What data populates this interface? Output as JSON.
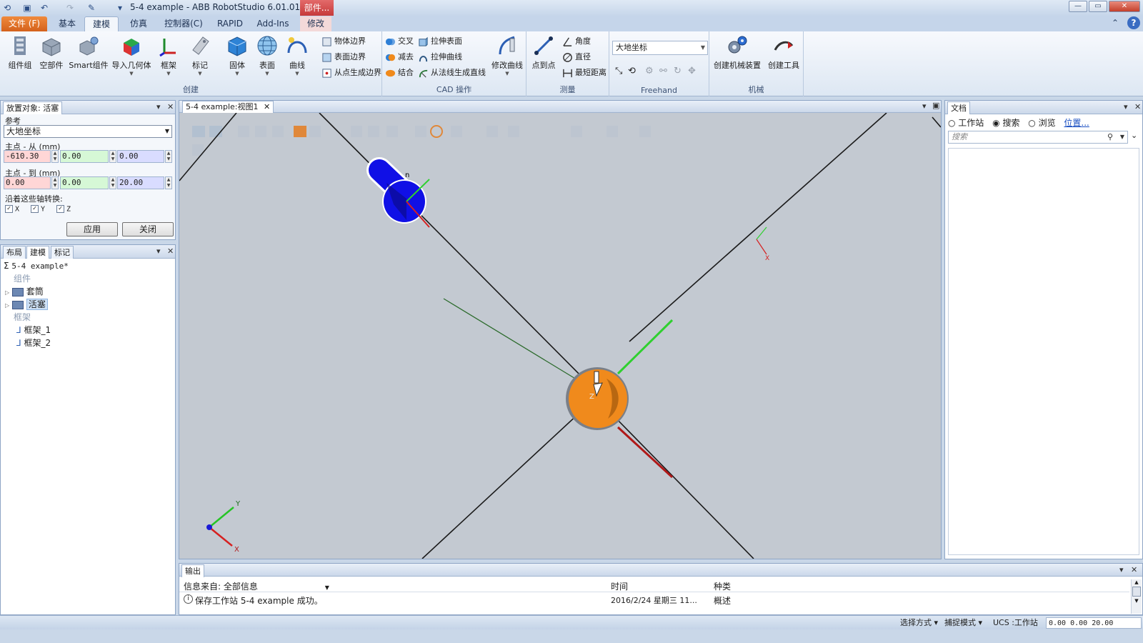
{
  "window": {
    "title": "5-4 example - ABB RobotStudio 6.01.01",
    "context_tab": "部件..."
  },
  "quick_access": [
    "app-icon",
    "save-icon",
    "undo-icon",
    "redo-icon",
    "tool-icon",
    "customize-icon"
  ],
  "tabs": {
    "file": "文件 (F)",
    "basic": "基本",
    "modeling": "建模",
    "simulation": "仿真",
    "controller": "控制器(C)",
    "rapid": "RAPID",
    "addins": "Add-Ins",
    "modify": "修改"
  },
  "ribbon": {
    "create": {
      "label": "创建",
      "component_group": "组件组",
      "empty_part": "空部件",
      "smart_component": "Smart组件",
      "import_geometry": "导入几何体",
      "frame": "框架",
      "tag": "标记",
      "solid": "固体",
      "surface": "表面",
      "curve": "曲线",
      "body_border": "物体边界",
      "surface_border": "表面边界",
      "border_from_point": "从点生成边界"
    },
    "cad": {
      "label": "CAD 操作",
      "intersect": "交叉",
      "subtract": "减去",
      "union": "结合",
      "extrude_surface": "拉伸表面",
      "extrude_curve": "拉伸曲线",
      "line_from_normal": "从法线生成直线",
      "modify_curve": "修改曲线"
    },
    "measure": {
      "label": "测量",
      "point_to_point": "点到点",
      "angle": "角度",
      "diameter": "直径",
      "min_distance": "最短距离"
    },
    "freehand": {
      "label": "Freehand",
      "reference": "大地坐标"
    },
    "mechanism": {
      "label": "机械",
      "create_mechanism": "创建机械装置",
      "create_tool": "创建工具"
    }
  },
  "place_panel": {
    "title": "放置对象: 活塞",
    "reference_label": "参考",
    "reference_value": "大地坐标",
    "from_label": "主点 - 从 (mm)",
    "from_x": "-610.30",
    "from_y": "0.00",
    "from_z": "0.00",
    "to_label": "主点 - 到 (mm)",
    "to_x": "0.00",
    "to_y": "0.00",
    "to_z": "20.00",
    "axes_label": "沿着这些轴转换:",
    "axis_x": "X",
    "axis_y": "Y",
    "axis_z": "Z",
    "apply": "应用",
    "close": "关闭"
  },
  "browser": {
    "tabs": [
      "布局",
      "建模",
      "标记"
    ],
    "station": "5-4 example*",
    "components_label": "组件",
    "parts": [
      "套筒",
      "活塞"
    ],
    "frames_label": "框架",
    "frames": [
      "框架_1",
      "框架_2"
    ]
  },
  "viewport": {
    "tab": "5-4 example:视图1",
    "axis_x": "X",
    "axis_y": "Y",
    "axis_z": "Z",
    "mark_n": "n"
  },
  "documents": {
    "title": "文档",
    "opt_station": "工作站",
    "opt_search": "搜索",
    "opt_browse": "浏览",
    "location_link": "位置...",
    "search_placeholder": "搜索"
  },
  "output": {
    "title": "输出",
    "source_label": "信息来自: 全部信息",
    "col_time": "时间",
    "col_type": "种类",
    "message": "保存工作站 5-4 example 成功。",
    "time": "2016/2/24 星期三 11...",
    "type": "概述"
  },
  "status": {
    "selection_mode": "选择方式",
    "snap_mode": "捕捉模式",
    "ucs": "UCS :工作站",
    "x": "0.00",
    "y": "0.00",
    "z": "20.00"
  },
  "colors": {
    "piston": "#1010e6",
    "sleeve": "#f08a1c",
    "viewport_bg": "#c3c9d1"
  }
}
